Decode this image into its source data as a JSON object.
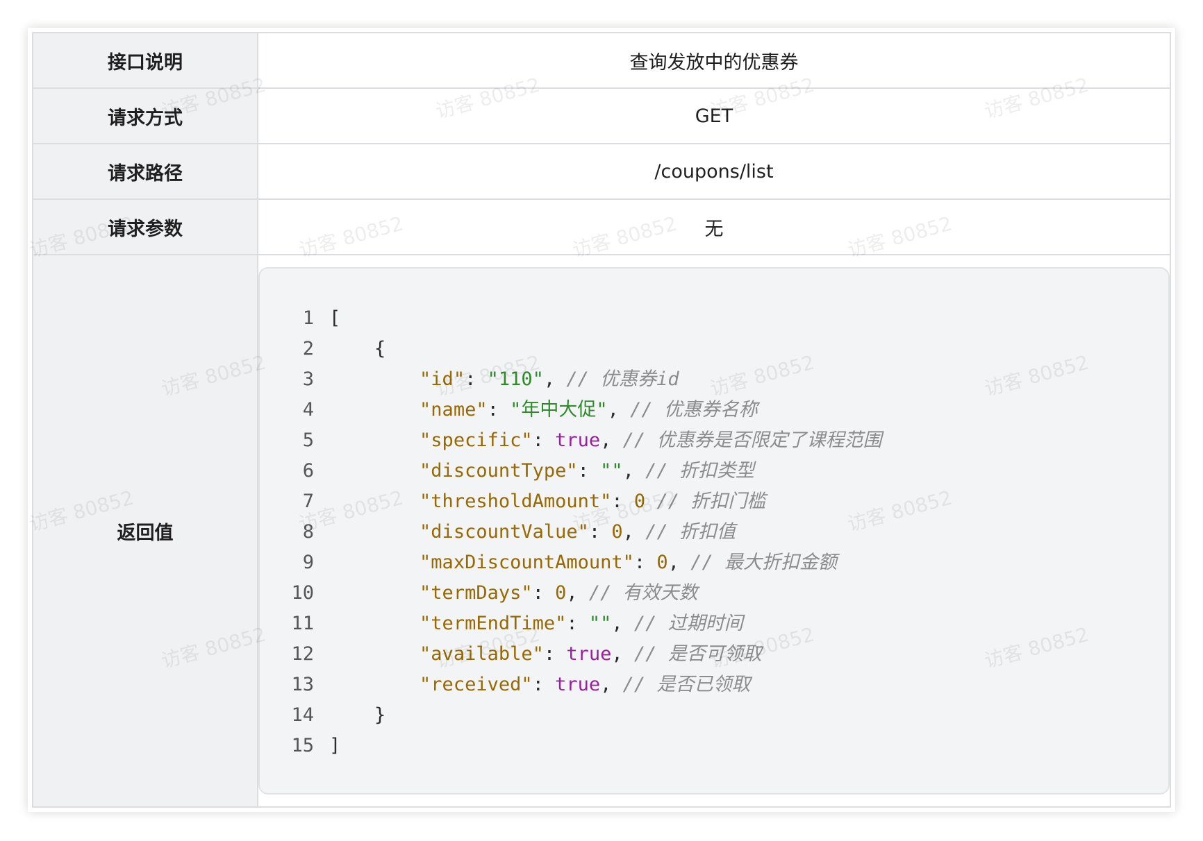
{
  "table": {
    "rows": [
      {
        "key": "接口说明",
        "value": "查询发放中的优惠券"
      },
      {
        "key": "请求方式",
        "value": "GET"
      },
      {
        "key": "请求路径",
        "value": "/coupons/list"
      },
      {
        "key": "请求参数",
        "value": "无"
      }
    ],
    "return_key": "返回值"
  },
  "code": {
    "lines": [
      {
        "num": "1",
        "text": "["
      },
      {
        "num": "2",
        "text": "    {"
      },
      {
        "num": "3",
        "key": "\"id\"",
        "value": "\"110\"",
        "value_type": "string",
        "sep": ", ",
        "comment": "// 优惠券id"
      },
      {
        "num": "4",
        "key": "\"name\"",
        "value": "\"年中大促\"",
        "value_type": "string",
        "sep": ", ",
        "comment": "// 优惠券名称"
      },
      {
        "num": "5",
        "key": "\"specific\"",
        "value": "true",
        "value_type": "bool",
        "sep": ", ",
        "comment": "// 优惠券是否限定了课程范围"
      },
      {
        "num": "6",
        "key": "\"discountType\"",
        "value": "\"\"",
        "value_type": "string",
        "sep": ", ",
        "comment": "// 折扣类型"
      },
      {
        "num": "7",
        "key": "\"thresholdAmount\"",
        "value": "0",
        "value_type": "number",
        "sep": " ",
        "comment": "// 折扣门槛"
      },
      {
        "num": "8",
        "key": "\"discountValue\"",
        "value": "0",
        "value_type": "number",
        "sep": ", ",
        "comment": "// 折扣值"
      },
      {
        "num": "9",
        "key": "\"maxDiscountAmount\"",
        "value": "0",
        "value_type": "number",
        "sep": ", ",
        "comment": "// 最大折扣金额"
      },
      {
        "num": "10",
        "key": "\"termDays\"",
        "value": "0",
        "value_type": "number",
        "sep": ", ",
        "comment": "// 有效天数"
      },
      {
        "num": "11",
        "key": "\"termEndTime\"",
        "value": "\"\"",
        "value_type": "string",
        "sep": ", ",
        "comment": "// 过期时间"
      },
      {
        "num": "12",
        "key": "\"available\"",
        "value": "true",
        "value_type": "bool",
        "sep": ", ",
        "comment": "// 是否可领取"
      },
      {
        "num": "13",
        "key": "\"received\"",
        "value": "true",
        "value_type": "bool",
        "sep": ", ",
        "comment": "// 是否已领取"
      },
      {
        "num": "14",
        "text": "    }"
      },
      {
        "num": "15",
        "text": "]"
      }
    ]
  },
  "watermark": "访客 80852",
  "colors": {
    "key_bg": "#f0f1f3",
    "code_bg": "#f3f4f6",
    "json_key": "#986801",
    "json_string": "#2f8a2a",
    "json_bool": "#9a1fa0",
    "json_number": "#986801",
    "comment": "#8c8c8c"
  }
}
